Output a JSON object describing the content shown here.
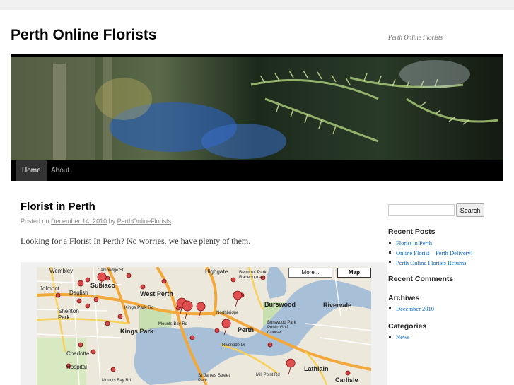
{
  "site": {
    "title": "Perth Online Florists",
    "description": "Perth Online Florists"
  },
  "nav": {
    "items": [
      {
        "label": "Home",
        "active": true
      },
      {
        "label": "About",
        "active": false
      }
    ]
  },
  "post": {
    "title": "Florist in Perth",
    "posted_on": "Posted on",
    "date": "December 14, 2010",
    "by": "by",
    "author": "PerthOnlineFlorists",
    "body": "Looking for a Florist In Perth? No worries, we have plenty of them."
  },
  "map": {
    "buttons": {
      "more": "More...",
      "map": "Map"
    },
    "labels": [
      "Wembley",
      "Cambridge St",
      "Highgate",
      "Belmont Park Racecourse",
      "Jolmont",
      "Daglish",
      "Subiaco",
      "West Perth",
      "Kings Park Rd",
      "Northbridge",
      "Mounts Bay Rd",
      "Burswood",
      "Rivervale",
      "Shenton Park",
      "Kings Park",
      "Perth",
      "Burswood Park Public Golf Course",
      "Riverside Dr",
      "Charlotte",
      "Hospital",
      "Lathlain",
      "Carlisle",
      "St Jarres Street Park",
      "Mill Point Rd",
      "Mounts Bay Rd"
    ]
  },
  "sidebar": {
    "search": {
      "placeholder": "",
      "button": "Search"
    },
    "recent_posts": {
      "title": "Recent Posts",
      "items": [
        "Florist in Perth",
        "Online Florist – Perth Delivery!",
        "Perth Online Florists Returns"
      ]
    },
    "recent_comments": {
      "title": "Recent Comments"
    },
    "archives": {
      "title": "Archives",
      "items": [
        "December 2010"
      ]
    },
    "categories": {
      "title": "Categories",
      "items": [
        "News"
      ]
    }
  },
  "colors": {
    "link": "#0066cc",
    "nav_bg": "#000000",
    "map_water": "#a8bfd8",
    "map_road": "#f2a83a"
  }
}
